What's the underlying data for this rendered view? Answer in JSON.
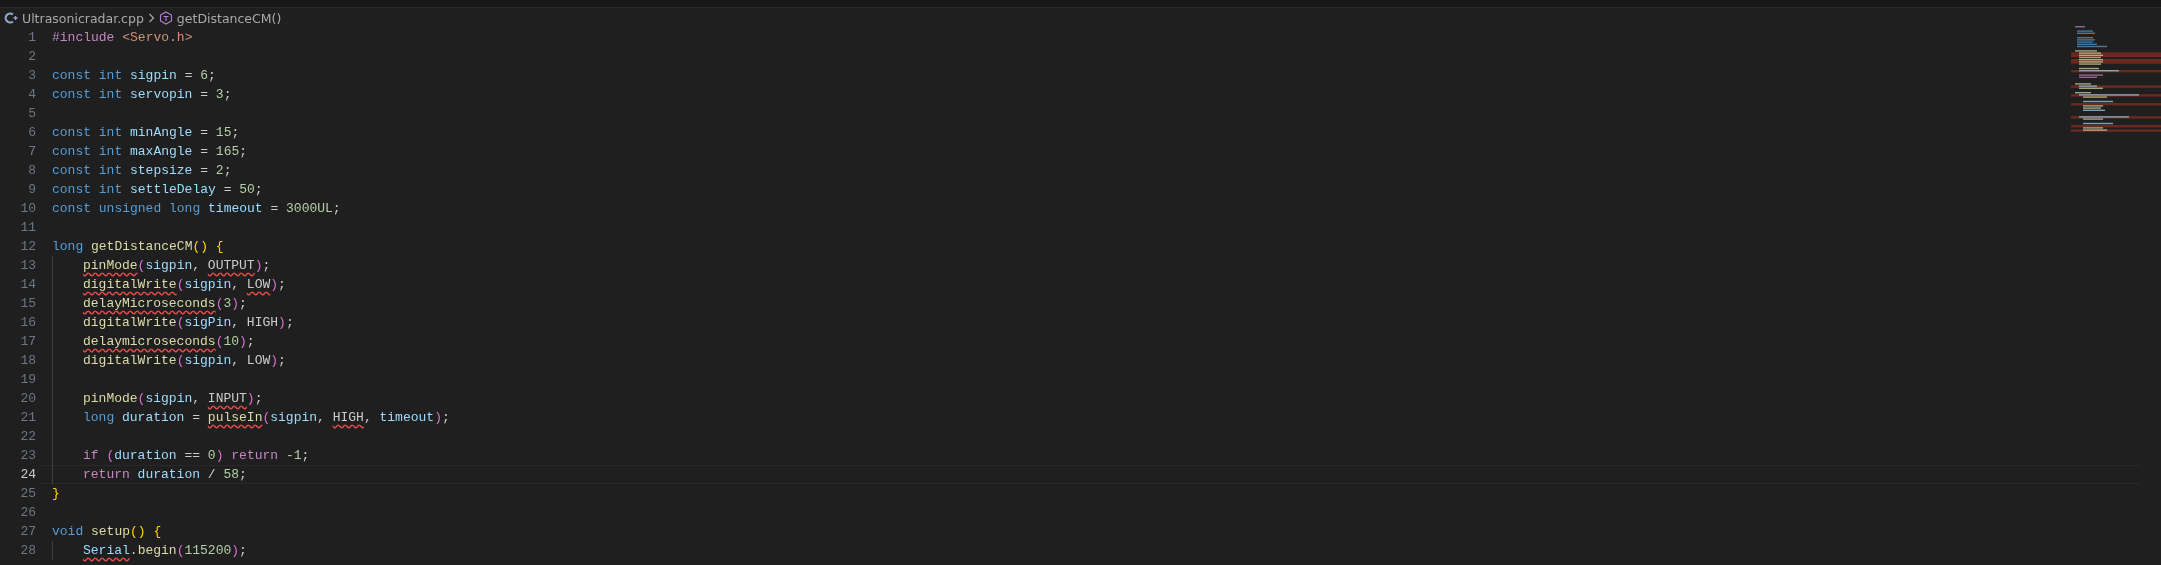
{
  "breadcrumb": {
    "file": "Ultrasonicradar.cpp",
    "symbol": "getDistanceCM()"
  },
  "lines": [
    {
      "number": "1",
      "indented": false,
      "current": false,
      "tokens": [
        {
          "t": "#include",
          "color": "#c586c0"
        },
        {
          "t": " <Servo.h>",
          "color": "#ce9178"
        }
      ]
    },
    {
      "number": "2",
      "indented": false,
      "current": false
    },
    {
      "number": "3",
      "indented": false,
      "current": false,
      "tokens": [
        {
          "t": "const int ",
          "color": "#569cd6"
        },
        {
          "t": "sigpin",
          "color": "#9cdcfe"
        },
        {
          "t": " = "
        },
        {
          "t": "6",
          "color": "#b5cea8"
        },
        {
          "t": ";"
        }
      ]
    },
    {
      "number": "4",
      "indented": false,
      "current": false,
      "tokens": [
        {
          "t": "const int ",
          "color": "#569cd6"
        },
        {
          "t": "servopin",
          "color": "#9cdcfe"
        },
        {
          "t": " = "
        },
        {
          "t": "3",
          "color": "#b5cea8"
        },
        {
          "t": ";"
        }
      ]
    },
    {
      "number": "5",
      "indented": false,
      "current": false
    },
    {
      "number": "6",
      "indented": false,
      "current": false,
      "tokens": [
        {
          "t": "const int ",
          "color": "#569cd6"
        },
        {
          "t": "minAngle",
          "color": "#9cdcfe"
        },
        {
          "t": " = "
        },
        {
          "t": "15",
          "color": "#b5cea8"
        },
        {
          "t": ";"
        }
      ]
    },
    {
      "number": "7",
      "indented": false,
      "current": false,
      "tokens": [
        {
          "t": "const int ",
          "color": "#569cd6"
        },
        {
          "t": "maxAngle",
          "color": "#9cdcfe"
        },
        {
          "t": " = "
        },
        {
          "t": "165",
          "color": "#b5cea8"
        },
        {
          "t": ";"
        }
      ]
    },
    {
      "number": "8",
      "indented": false,
      "current": false,
      "tokens": [
        {
          "t": "const int ",
          "color": "#569cd6"
        },
        {
          "t": "stepsize",
          "color": "#9cdcfe"
        },
        {
          "t": " = "
        },
        {
          "t": "2",
          "color": "#b5cea8"
        },
        {
          "t": ";"
        }
      ]
    },
    {
      "number": "9",
      "indented": false,
      "current": false,
      "tokens": [
        {
          "t": "const int ",
          "color": "#569cd6"
        },
        {
          "t": "settleDelay",
          "color": "#9cdcfe"
        },
        {
          "t": " = "
        },
        {
          "t": "50",
          "color": "#b5cea8"
        },
        {
          "t": ";"
        }
      ]
    },
    {
      "number": "10",
      "indented": false,
      "current": false,
      "tokens": [
        {
          "t": "const unsigned long ",
          "color": "#569cd6"
        },
        {
          "t": "timeout",
          "color": "#9cdcfe"
        },
        {
          "t": " = "
        },
        {
          "t": "3000UL",
          "color": "#b5cea8"
        },
        {
          "t": ";"
        }
      ]
    },
    {
      "number": "11",
      "indented": false,
      "current": false
    },
    {
      "number": "12",
      "indented": false,
      "current": false,
      "tokens": [
        {
          "t": "long ",
          "color": "#569cd6"
        },
        {
          "t": "getDistanceCM",
          "color": "#dcdcaa"
        },
        {
          "t": "() {",
          "kind": "brace"
        }
      ]
    },
    {
      "number": "13",
      "indented": true,
      "current": false,
      "tokens": [
        {
          "t": "pinMode",
          "color": "#dcdcaa",
          "error": true
        },
        {
          "t": "(",
          "kind": "paren"
        },
        {
          "t": "sigpin",
          "color": "#9cdcfe"
        },
        {
          "t": ", "
        },
        {
          "t": "OUTPUT",
          "error": true
        },
        {
          "t": ")",
          "kind": "paren"
        },
        {
          "t": ";"
        }
      ]
    },
    {
      "number": "14",
      "indented": true,
      "current": false,
      "tokens": [
        {
          "t": "digitalWrite",
          "color": "#dcdcaa",
          "error": true
        },
        {
          "t": "(",
          "kind": "paren"
        },
        {
          "t": "sigpin",
          "color": "#9cdcfe"
        },
        {
          "t": ", "
        },
        {
          "t": "LOW",
          "error": true
        },
        {
          "t": ")",
          "kind": "paren"
        },
        {
          "t": ";"
        }
      ]
    },
    {
      "number": "15",
      "indented": true,
      "current": false,
      "tokens": [
        {
          "t": "delayMicroseconds",
          "color": "#dcdcaa",
          "error": true
        },
        {
          "t": "(",
          "kind": "paren"
        },
        {
          "t": "3",
          "color": "#b5cea8"
        },
        {
          "t": ")",
          "kind": "paren"
        },
        {
          "t": ";"
        }
      ]
    },
    {
      "number": "16",
      "indented": true,
      "current": false,
      "tokens": [
        {
          "t": "digitalWrite",
          "color": "#dcdcaa"
        },
        {
          "t": "(",
          "kind": "paren"
        },
        {
          "t": "sigPin",
          "color": "#9cdcfe"
        },
        {
          "t": ", HIGH"
        },
        {
          "t": ")",
          "kind": "paren"
        },
        {
          "t": ";"
        }
      ]
    },
    {
      "number": "17",
      "indented": true,
      "current": false,
      "tokens": [
        {
          "t": "delaymicroseconds",
          "color": "#dcdcaa",
          "error": true
        },
        {
          "t": "(",
          "kind": "paren"
        },
        {
          "t": "10",
          "color": "#b5cea8"
        },
        {
          "t": ")",
          "kind": "paren"
        },
        {
          "t": ";"
        }
      ]
    },
    {
      "number": "18",
      "indented": true,
      "current": false,
      "tokens": [
        {
          "t": "digitalWrite",
          "color": "#dcdcaa"
        },
        {
          "t": "(",
          "kind": "paren"
        },
        {
          "t": "sigpin",
          "color": "#9cdcfe"
        },
        {
          "t": ", LOW"
        },
        {
          "t": ")",
          "kind": "paren"
        },
        {
          "t": ";"
        }
      ]
    },
    {
      "number": "19",
      "indented": true,
      "current": false
    },
    {
      "number": "20",
      "indented": true,
      "current": false,
      "tokens": [
        {
          "t": "pinMode",
          "color": "#dcdcaa"
        },
        {
          "t": "(",
          "kind": "paren"
        },
        {
          "t": "sigpin",
          "color": "#9cdcfe"
        },
        {
          "t": ", "
        },
        {
          "t": "INPUT",
          "error": true
        },
        {
          "t": ")",
          "kind": "paren"
        },
        {
          "t": ";"
        }
      ]
    },
    {
      "number": "21",
      "indented": true,
      "current": false,
      "tokens": [
        {
          "t": "long ",
          "color": "#569cd6"
        },
        {
          "t": "duration",
          "color": "#9cdcfe"
        },
        {
          "t": " = "
        },
        {
          "t": "pulseIn",
          "color": "#dcdcaa",
          "error": true
        },
        {
          "t": "(",
          "kind": "paren"
        },
        {
          "t": "sigpin",
          "color": "#9cdcfe"
        },
        {
          "t": ", "
        },
        {
          "t": "HIGH",
          "error": true
        },
        {
          "t": ", "
        },
        {
          "t": "timeout",
          "color": "#9cdcfe"
        },
        {
          "t": ")",
          "kind": "paren"
        },
        {
          "t": ";"
        }
      ]
    },
    {
      "number": "22",
      "indented": true,
      "current": false
    },
    {
      "number": "23",
      "indented": true,
      "current": false,
      "tokens": [
        {
          "t": "if ",
          "color": "#c586c0"
        },
        {
          "t": "(",
          "kind": "paren"
        },
        {
          "t": "duration",
          "color": "#9cdcfe"
        },
        {
          "t": " == "
        },
        {
          "t": "0",
          "color": "#b5cea8"
        },
        {
          "t": ")",
          "kind": "paren"
        },
        {
          "t": " return ",
          "color": "#c586c0"
        },
        {
          "t": "-1",
          "color": "#b5cea8"
        },
        {
          "t": ";"
        }
      ]
    },
    {
      "number": "24",
      "indented": true,
      "current": true,
      "tokens": [
        {
          "t": "return ",
          "color": "#c586c0"
        },
        {
          "t": "duration",
          "color": "#9cdcfe"
        },
        {
          "t": " / "
        },
        {
          "t": "58",
          "color": "#b5cea8"
        },
        {
          "t": ";"
        }
      ]
    },
    {
      "number": "25",
      "indented": false,
      "current": false,
      "tokens": [
        {
          "t": "}",
          "kind": "brace"
        }
      ]
    },
    {
      "number": "26",
      "indented": false,
      "current": false
    },
    {
      "number": "27",
      "indented": false,
      "current": false,
      "tokens": [
        {
          "t": "void ",
          "color": "#569cd6"
        },
        {
          "t": "setup",
          "color": "#dcdcaa"
        },
        {
          "t": "() {",
          "kind": "brace"
        }
      ]
    },
    {
      "number": "28",
      "indented": true,
      "current": false,
      "tokens": [
        {
          "t": "Serial",
          "color": "#9cdcfe",
          "error": true
        },
        {
          "t": "."
        },
        {
          "t": "begin",
          "color": "#dcdcaa"
        },
        {
          "t": "(",
          "kind": "paren"
        },
        {
          "t": "115200",
          "color": "#b5cea8"
        },
        {
          "t": ")",
          "kind": "paren"
        },
        {
          "t": ";"
        }
      ]
    }
  ]
}
